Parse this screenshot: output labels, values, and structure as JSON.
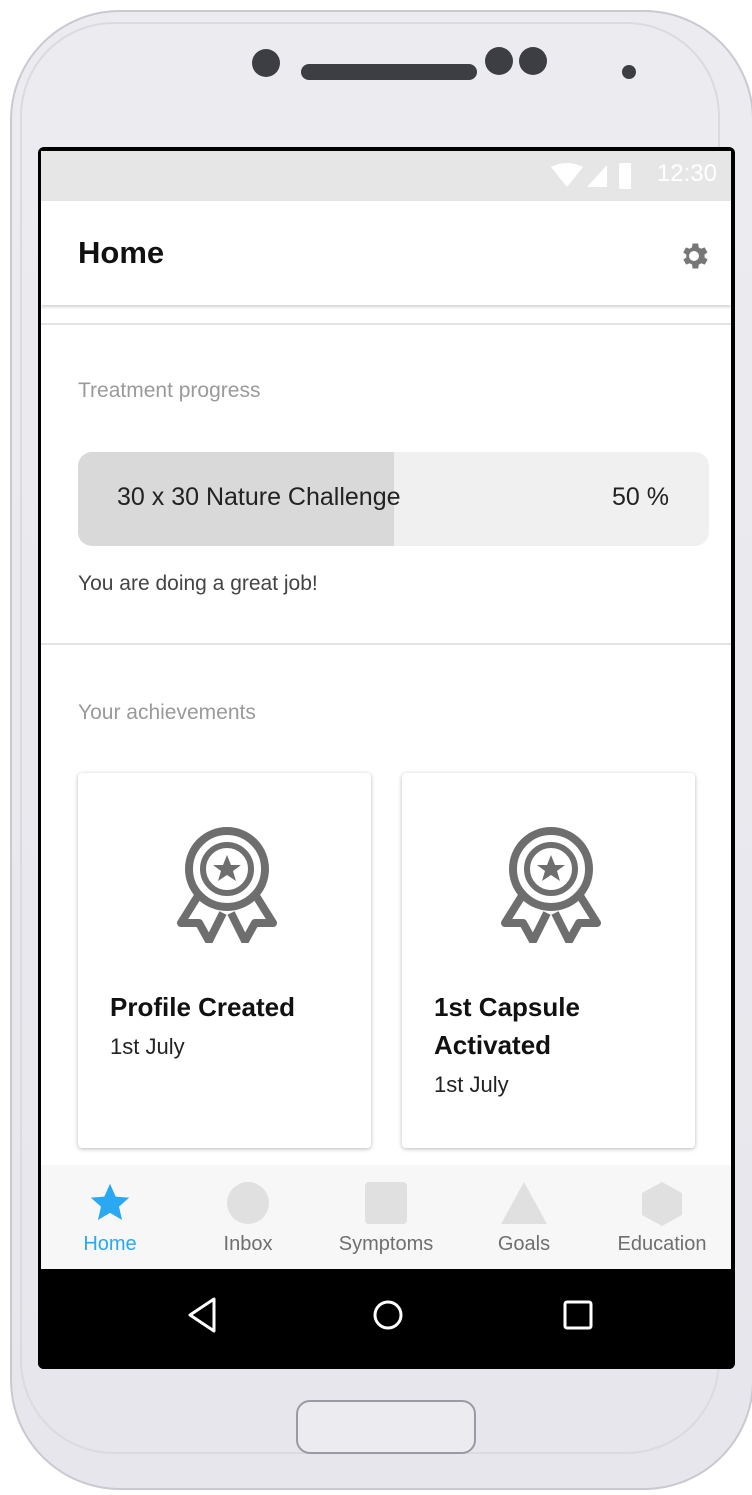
{
  "status_bar": {
    "time": "12:30"
  },
  "header": {
    "title": "Home"
  },
  "progress_section": {
    "label": "Treatment progress",
    "item_name": "30 x 30 Nature Challenge",
    "percent_text": "50 %",
    "percent_value": 50,
    "message": "You are doing a great job!"
  },
  "achievements_section": {
    "label": "Your achievements",
    "cards": [
      {
        "title": "Profile Created",
        "date": "1st July"
      },
      {
        "title": "1st Capsule Activated",
        "date": "1st July"
      }
    ]
  },
  "bottom_nav": {
    "items": [
      {
        "label": "Home",
        "icon": "star-icon",
        "active": true
      },
      {
        "label": "Inbox",
        "icon": "circle-icon"
      },
      {
        "label": "Symptoms",
        "icon": "square-icon"
      },
      {
        "label": "Goals",
        "icon": "triangle-icon"
      },
      {
        "label": "Education",
        "icon": "hexagon-icon"
      }
    ]
  },
  "colors": {
    "accent": "#2aa8f2",
    "progress_fill": "#d9d9d9",
    "progress_track": "#f0f0f0"
  }
}
